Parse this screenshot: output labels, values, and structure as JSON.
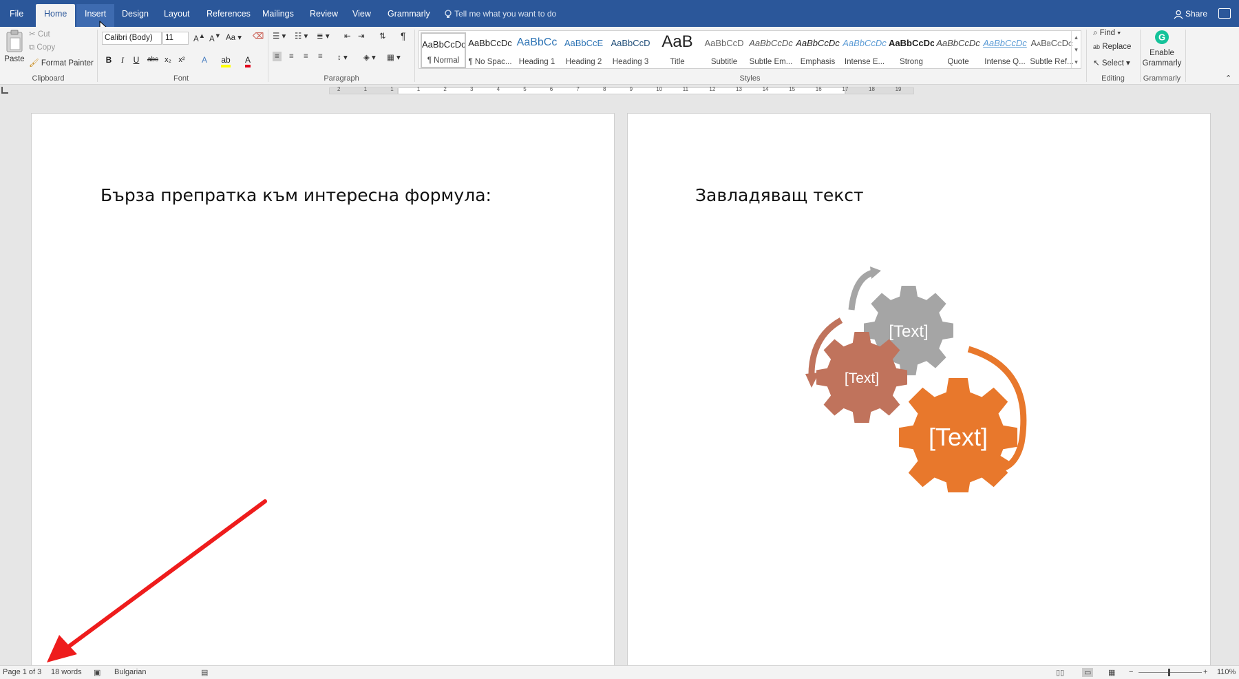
{
  "tabs": {
    "file": "File",
    "home": "Home",
    "insert": "Insert",
    "design": "Design",
    "layout": "Layout",
    "references": "References",
    "mailings": "Mailings",
    "review": "Review",
    "view": "View",
    "grammarly": "Grammarly"
  },
  "tell_me": "Tell me what you want to do",
  "share": "Share",
  "clipboard": {
    "paste": "Paste",
    "cut": "Cut",
    "copy": "Copy",
    "format_painter": "Format Painter",
    "label": "Clipboard"
  },
  "font": {
    "name": "Calibri (Body)",
    "size": "11",
    "label": "Font",
    "change_case": "Aa"
  },
  "paragraph": {
    "label": "Paragraph"
  },
  "styles": {
    "label": "Styles",
    "items": [
      {
        "preview": "AaBbCcDc",
        "name": "¶ Normal"
      },
      {
        "preview": "AaBbCcDc",
        "name": "¶ No Spac..."
      },
      {
        "preview": "AaBbCc",
        "name": "Heading 1"
      },
      {
        "preview": "AaBbCcE",
        "name": "Heading 2"
      },
      {
        "preview": "AaBbCcD",
        "name": "Heading 3"
      },
      {
        "preview": "AaB",
        "name": "Title"
      },
      {
        "preview": "AaBbCcD",
        "name": "Subtitle"
      },
      {
        "preview": "AaBbCcDc",
        "name": "Subtle Em..."
      },
      {
        "preview": "AaBbCcDc",
        "name": "Emphasis"
      },
      {
        "preview": "AaBbCcDc",
        "name": "Intense E..."
      },
      {
        "preview": "AaBbCcDc",
        "name": "Strong"
      },
      {
        "preview": "AaBbCcDc",
        "name": "Quote"
      },
      {
        "preview": "AaBbCcDc",
        "name": "Intense Q..."
      },
      {
        "preview": "AaBbCcDc",
        "name": "Subtle Ref..."
      }
    ]
  },
  "editing": {
    "find": "Find",
    "replace": "Replace",
    "select": "Select",
    "label": "Editing"
  },
  "grammarly_group": {
    "enable": "Enable",
    "grammarly": "Grammarly",
    "label": "Grammarly"
  },
  "ruler_numbers": [
    "2",
    "1",
    "1",
    "1",
    "2",
    "3",
    "4",
    "5",
    "6",
    "7",
    "8",
    "9",
    "10",
    "11",
    "12",
    "13",
    "14",
    "15",
    "16",
    "17",
    "18",
    "19"
  ],
  "page1": {
    "text": "Бърза препратка към интересна формула:"
  },
  "page2": {
    "text": "Завладяващ текст",
    "gears": [
      {
        "label": "[Text]",
        "color": "#a5a5a5"
      },
      {
        "label": "[Text]",
        "color": "#c0735c"
      },
      {
        "label": "[Text]",
        "color": "#e8782c"
      }
    ]
  },
  "status": {
    "page": "Page 1 of 3",
    "words": "18 words",
    "language": "Bulgarian",
    "zoom": "110%"
  },
  "colors": {
    "ribbon_blue": "#2b579a",
    "annotation_arrow": "#ee1c1c",
    "grammarly_green": "#15c39a"
  }
}
